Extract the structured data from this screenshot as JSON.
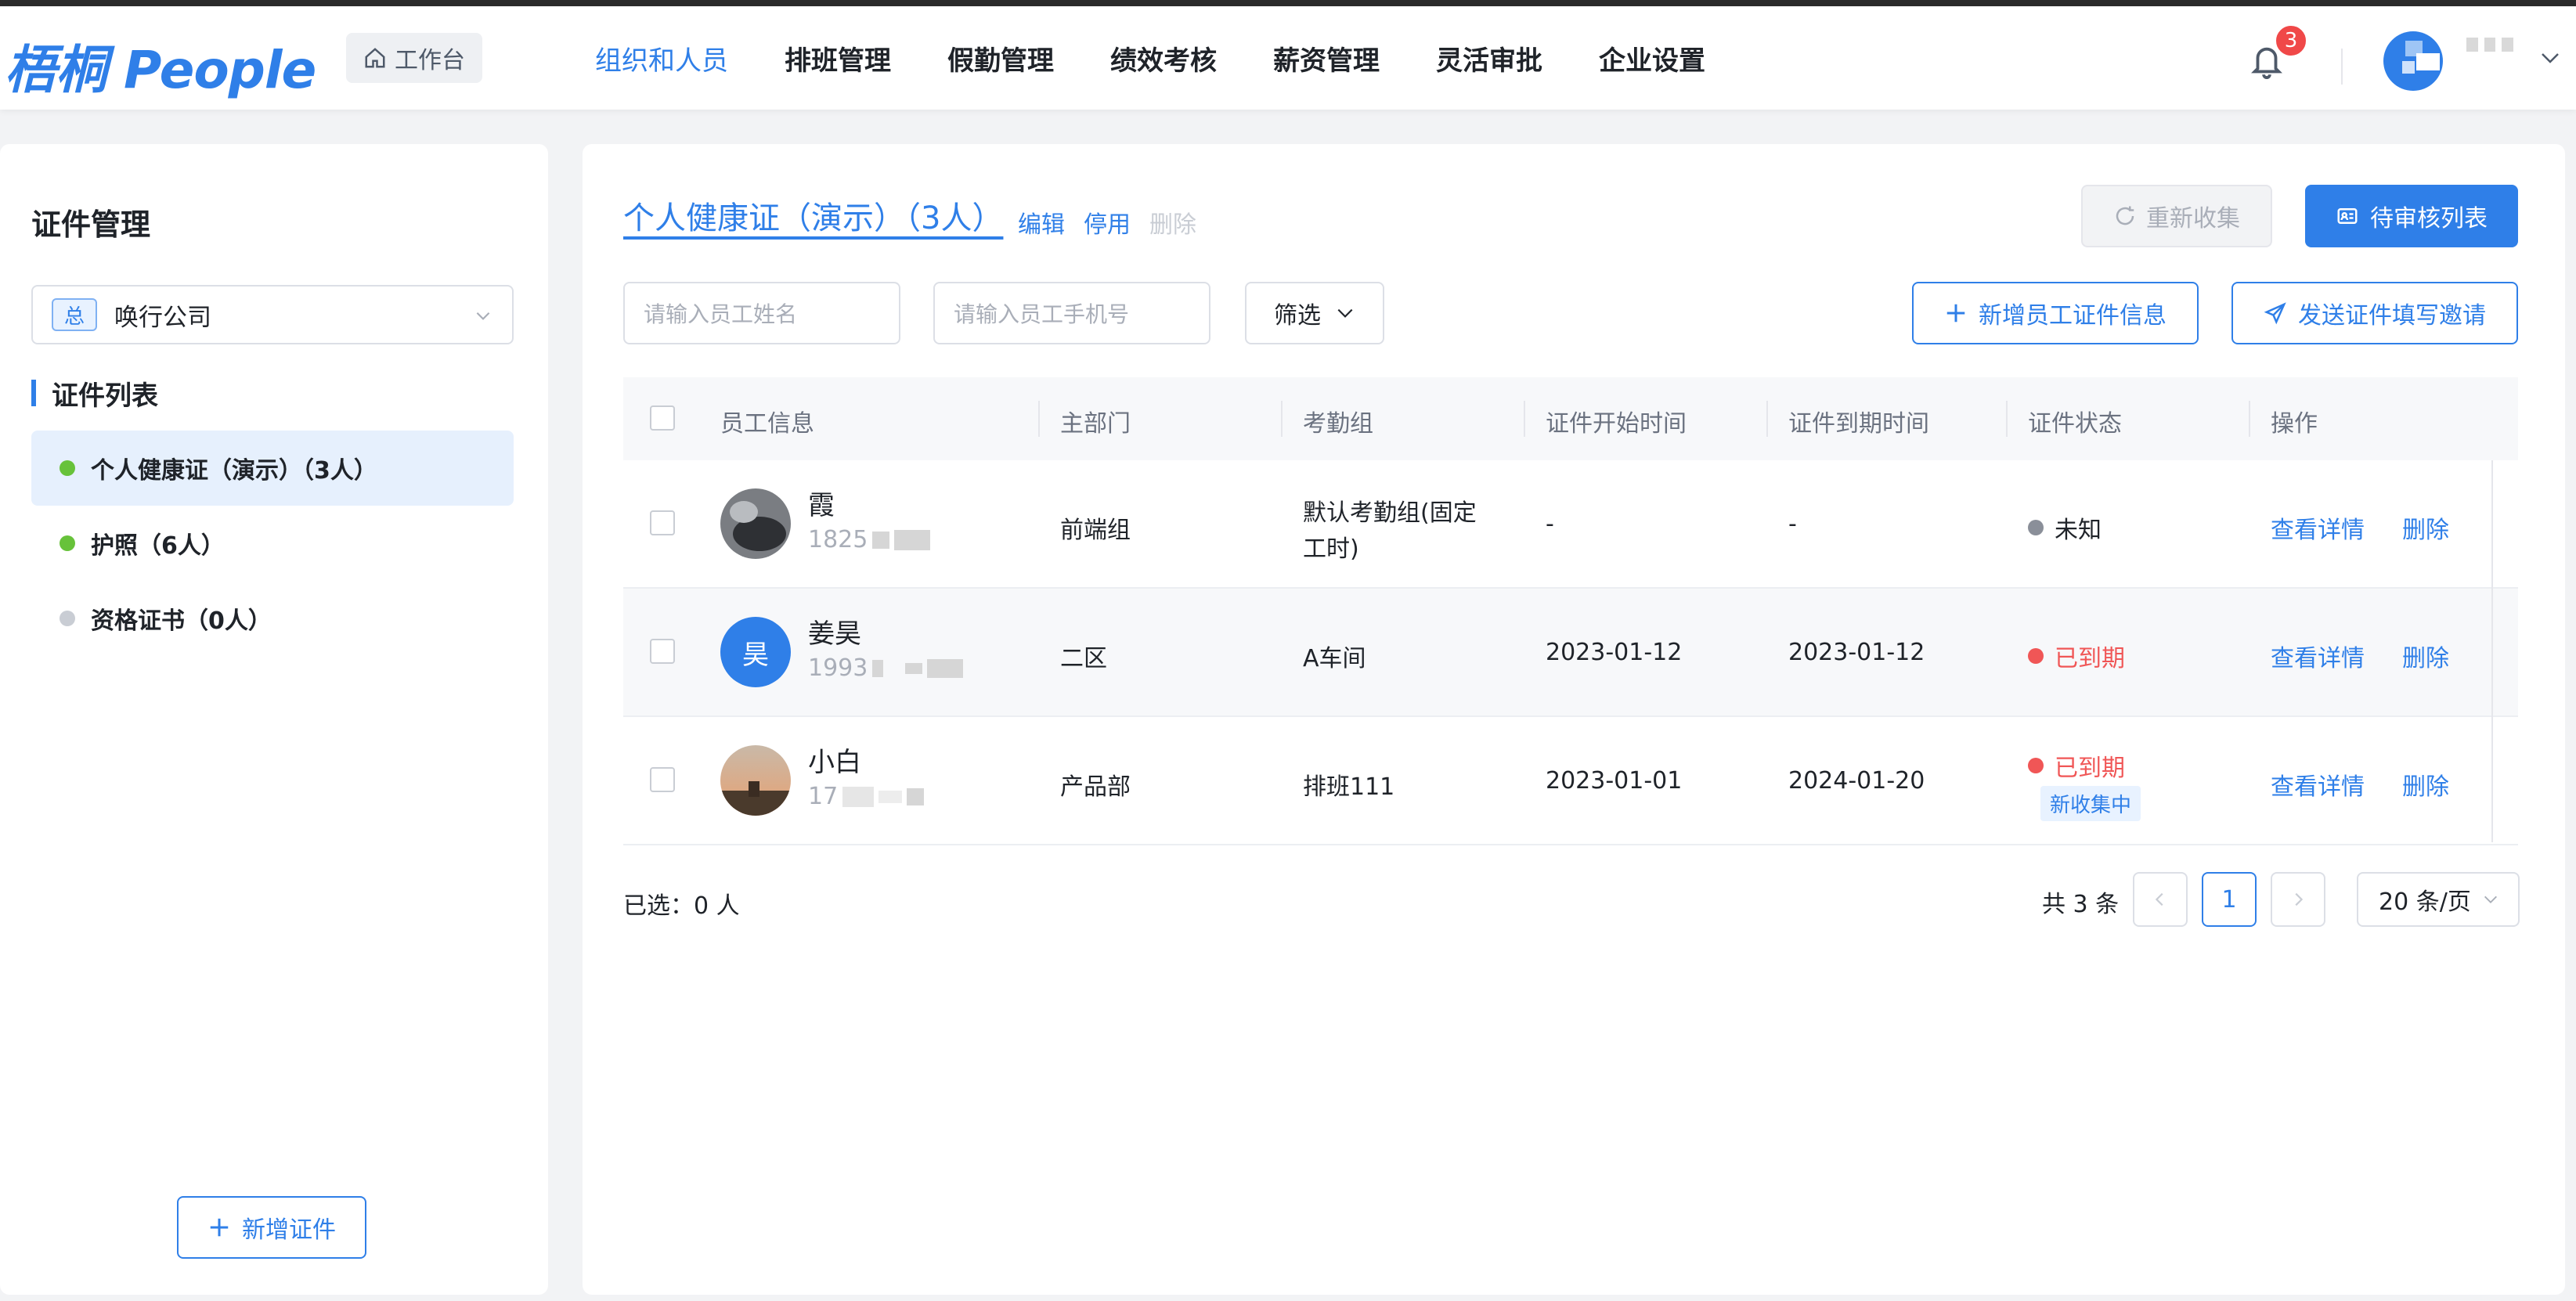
{
  "header": {
    "logo": "梧桐 People",
    "workbench": "工作台",
    "nav": [
      "组织和人员",
      "排班管理",
      "假勤管理",
      "绩效考核",
      "薪资管理",
      "灵活审批",
      "企业设置"
    ],
    "active_nav": "组织和人员",
    "notification_count": "3"
  },
  "sidebar": {
    "title": "证件管理",
    "company_tag": "总",
    "company_name": "唤行公司",
    "list_title": "证件列表",
    "items": [
      {
        "label": "个人健康证（演示）（3人）",
        "dot_color": "#67c23a"
      },
      {
        "label": "护照（6人）",
        "dot_color": "#67c23a"
      },
      {
        "label": "资格证书（0人）",
        "dot_color": "#c9cdd4"
      }
    ],
    "add_button": "新增证件"
  },
  "main": {
    "cert_title": "个人健康证（演示）（3人）",
    "edit": "编辑",
    "disable": "停用",
    "delete": "删除",
    "recollect": "重新收集",
    "pending_list": "待审核列表",
    "name_placeholder": "请输入员工姓名",
    "phone_placeholder": "请输入员工手机号",
    "filter": "筛选",
    "add_employee_cert": "新增员工证件信息",
    "send_invite": "发送证件填写邀请"
  },
  "table": {
    "columns": [
      "员工信息",
      "主部门",
      "考勤组",
      "证件开始时间",
      "证件到期时间",
      "证件状态",
      "操作"
    ],
    "rows": [
      {
        "name": "霞",
        "phone": "1825",
        "dept": "前端组",
        "group_line1": "默认考勤组(固定",
        "group_line2": "工时)",
        "start": "-",
        "end": "-",
        "status": "未知",
        "status_color": "#8a8f99",
        "tag": "",
        "view": "查看详情",
        "delete": "删除"
      },
      {
        "name": "姜昊",
        "avatar_text": "昊",
        "phone": "1993",
        "dept": "二区",
        "group_line1": "A车间",
        "group_line2": "",
        "start": "2023-01-12",
        "end": "2023-01-12",
        "status": "已到期",
        "status_color": "#f05656",
        "tag": "",
        "view": "查看详情",
        "delete": "删除"
      },
      {
        "name": "小白",
        "phone": "17",
        "dept": "产品部",
        "group_line1": "排班111",
        "group_line2": "",
        "start": "2023-01-01",
        "end": "2024-01-20",
        "status": "已到期",
        "status_color": "#f05656",
        "tag": "新收集中",
        "view": "查看详情",
        "delete": "删除"
      }
    ]
  },
  "footer": {
    "selected": "已选：0 人",
    "total": "共 3 条",
    "current_page": "1",
    "page_size": "20 条/页"
  },
  "colors": {
    "accent": "#2f7fe8",
    "expired": "#f05656",
    "unknown": "#8a8f99"
  }
}
